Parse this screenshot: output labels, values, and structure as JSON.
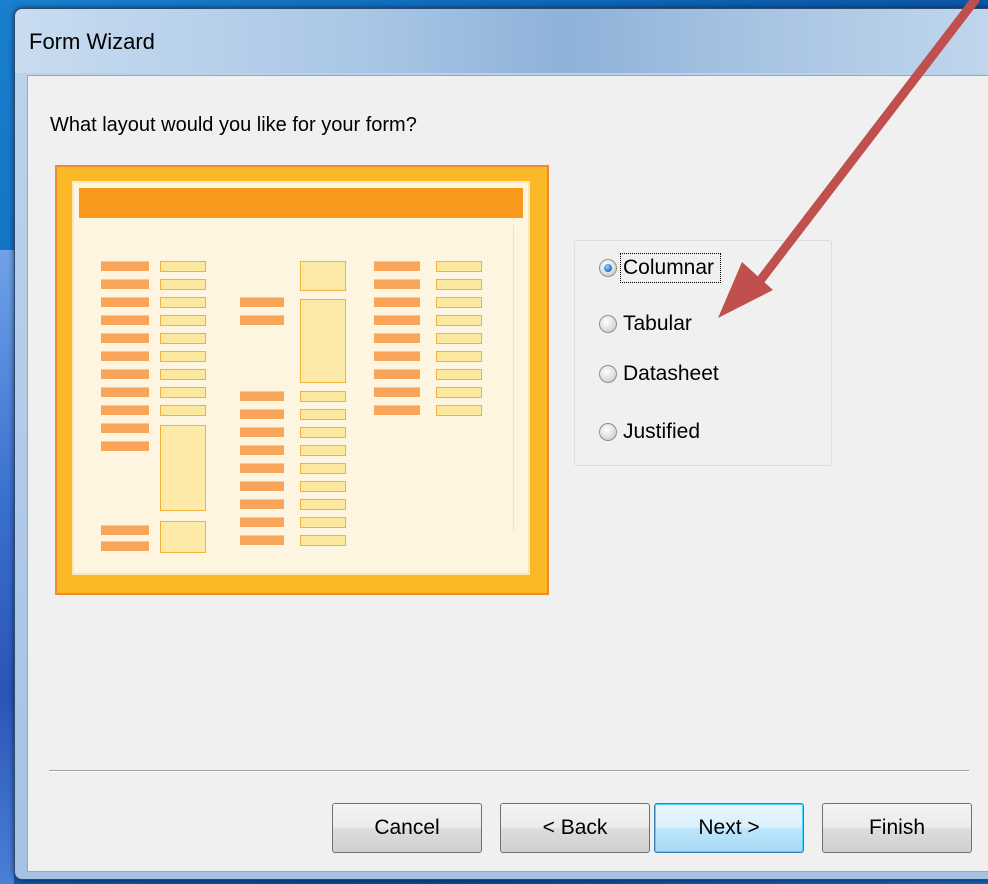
{
  "window": {
    "title": "Form Wizard"
  },
  "wizard": {
    "question": "What layout would you like for your form?",
    "layout_options": [
      {
        "label": "Columnar",
        "selected": true
      },
      {
        "label": "Tabular",
        "selected": false
      },
      {
        "label": "Datasheet",
        "selected": false
      },
      {
        "label": "Justified",
        "selected": false
      }
    ]
  },
  "buttons": {
    "cancel": "Cancel",
    "back": "< Back",
    "next": "Next >",
    "finish": "Finish"
  },
  "colors": {
    "preview_accent": "#f79a1b",
    "annotation_arrow": "#c0504d",
    "selected_radio": "#2a7bd0"
  }
}
